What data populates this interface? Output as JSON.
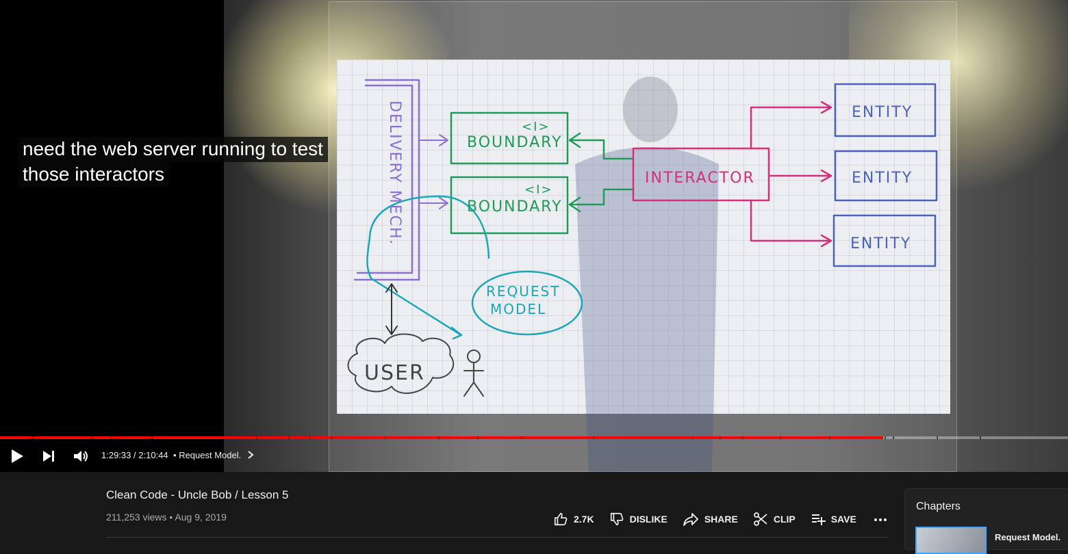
{
  "video": {
    "caption_lines": [
      "need the web server running to test",
      "those interactors"
    ],
    "whiteboard": {
      "delivery": "DELIVERY MECH.",
      "boundary_marker": "<I>",
      "boundary": "BOUNDARY",
      "interactor": "INTERACTOR",
      "entity": "ENTITY",
      "request_model": [
        "REQUEST",
        "MODEL"
      ],
      "user": "USER"
    },
    "colors": {
      "boundary": "#1f9a57",
      "interactor": "#d2307a",
      "entity": "#4a63b8",
      "delivery": "#8b6fd0",
      "user_flow": "#1aa6b7",
      "accent": "#ff0000"
    }
  },
  "player": {
    "progress": 0.827,
    "current_time": "1:29:33",
    "separator": "/",
    "duration": "2:10:44",
    "dot": "•",
    "chapter": "Request Model.",
    "icons": [
      "play-icon",
      "next-icon",
      "volume-icon",
      "chevron-right-icon"
    ]
  },
  "info": {
    "title": "Clean Code - Uncle Bob / Lesson 5",
    "views": "211,253 views",
    "dot": "•",
    "date": "Aug 9, 2019",
    "actions": {
      "like": "2.7K",
      "dislike": "DISLIKE",
      "share": "SHARE",
      "clip": "CLIP",
      "save": "SAVE"
    }
  },
  "chapters": {
    "title": "Chapters",
    "items": [
      {
        "label": "Request Model."
      }
    ]
  }
}
